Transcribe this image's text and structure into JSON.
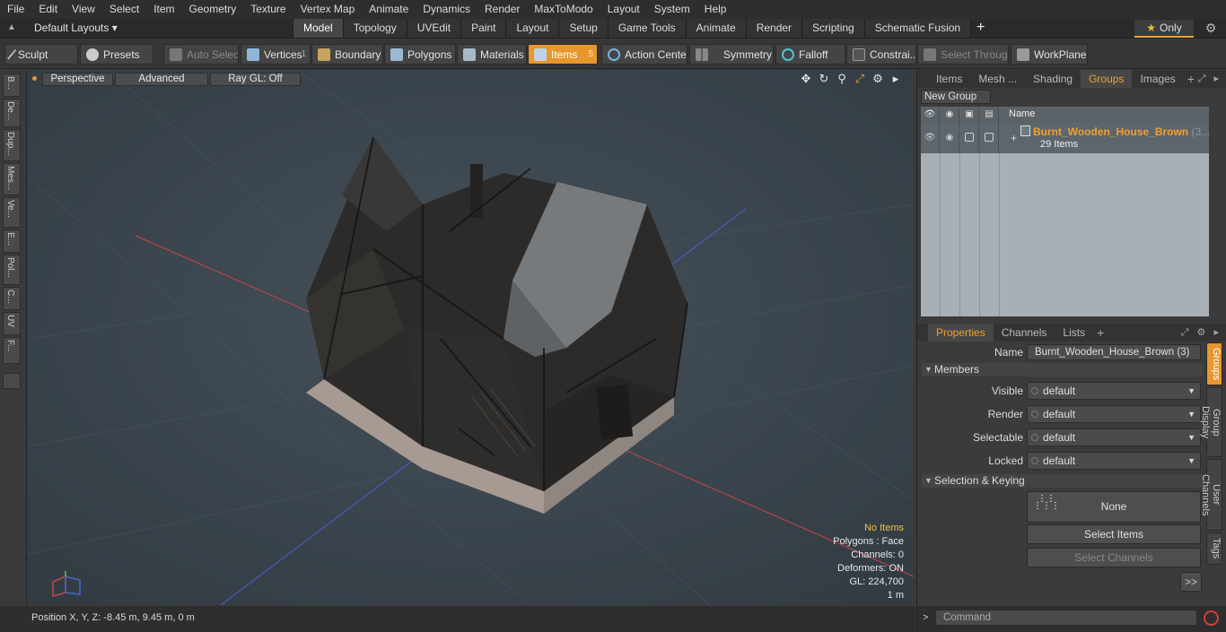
{
  "menu": [
    "File",
    "Edit",
    "View",
    "Select",
    "Item",
    "Geometry",
    "Texture",
    "Vertex Map",
    "Animate",
    "Dynamics",
    "Render",
    "MaxToModo",
    "Layout",
    "System",
    "Help"
  ],
  "layout": {
    "dropdown": "Default Layouts",
    "tabs": [
      "Model",
      "Topology",
      "UVEdit",
      "Paint",
      "Layout",
      "Setup",
      "Game Tools",
      "Animate",
      "Render",
      "Scripting",
      "Schematic Fusion"
    ],
    "active_tab": "Model",
    "only_label": "Only"
  },
  "toolbar": {
    "sculpt": "Sculpt",
    "presets": "Presets",
    "auto_select": "Auto Select",
    "vertices": "Vertices",
    "vertices_count": "1",
    "boundary": "Boundary",
    "polygons": "Polygons",
    "materials": "Materials",
    "items": "Items",
    "items_count": "5",
    "action_center": "Action Center",
    "symmetry": "Symmetry",
    "falloff": "Falloff",
    "constraints": "Constrai...",
    "select_through": "Select Through",
    "workplane": "WorkPlane"
  },
  "left_tabs": [
    "B...",
    "De...",
    "Dup...",
    "Mes...",
    "Ve...",
    "E...",
    "Pol...",
    "C...",
    "UV",
    "F..."
  ],
  "viewport": {
    "perspective": "Perspective",
    "advanced": "Advanced",
    "raygl": "Ray GL: Off",
    "stats": {
      "no_items": "No Items",
      "polygons": "Polygons : Face",
      "channels": "Channels: 0",
      "deformers": "Deformers: ON",
      "gl": "GL: 224,700",
      "scale": "1 m"
    }
  },
  "status": {
    "position": "Position X, Y, Z:   -8.45 m, 9.45 m, 0 m"
  },
  "panel_tabs": [
    "Items",
    "Mesh ...",
    "Shading",
    "Groups",
    "Images"
  ],
  "active_panel_tab": "Groups",
  "groups": {
    "new_group": "New Group",
    "col_name": "Name",
    "item_name": "Burnt_Wooden_House_Brown",
    "item_suffix": "(3...",
    "item_count": "29 Items"
  },
  "props_tabs": [
    "Properties",
    "Channels",
    "Lists"
  ],
  "active_props_tab": "Properties",
  "properties": {
    "name_label": "Name",
    "name_value": "Burnt_Wooden_House_Brown (3)",
    "members_section": "Members",
    "visible_label": "Visible",
    "visible_value": "default",
    "render_label": "Render",
    "render_value": "default",
    "selectable_label": "Selectable",
    "selectable_value": "default",
    "locked_label": "Locked",
    "locked_value": "default",
    "selkey_section": "Selection & Keying",
    "none_btn": "None",
    "select_items": "Select Items",
    "select_channels": "Select Channels",
    "expand": ">>"
  },
  "side_tabs": [
    "Groups",
    "Group Display",
    "User Channels",
    "Tags"
  ],
  "command": {
    "prompt": ">",
    "placeholder": "Command"
  },
  "colors": {
    "accent": "#e8962e",
    "viewport_bg": "#3a434a",
    "group_title": "#f0a030"
  }
}
